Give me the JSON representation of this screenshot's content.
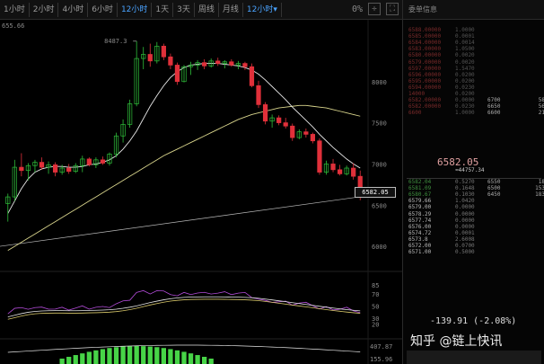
{
  "toolbar": {
    "timeframes": [
      "1小时",
      "2小时",
      "4小时",
      "6小时",
      "12小时",
      "1天",
      "3天",
      "周线",
      "月线",
      "12小时▾"
    ],
    "active": [
      4,
      9
    ],
    "icon_right_1": "0%",
    "icon_right_2": "crosshair-icon",
    "icon_right_3": "fullscreen-icon"
  },
  "chart_data": {
    "type": "candlestick",
    "y_range": [
      5750,
      8750
    ],
    "y_ticks": [
      8000,
      7500,
      7000,
      6500,
      6000
    ],
    "top_left_label": "655.66",
    "high_annotation": "8487.3",
    "current_price_tag": "6582.05",
    "candles": [
      {
        "o": 6520,
        "h": 6640,
        "l": 6300,
        "c": 6600
      },
      {
        "o": 6600,
        "h": 7050,
        "l": 6550,
        "c": 6960
      },
      {
        "o": 6960,
        "h": 7130,
        "l": 6850,
        "c": 6920
      },
      {
        "o": 6920,
        "h": 7010,
        "l": 6800,
        "c": 6980
      },
      {
        "o": 6980,
        "h": 7050,
        "l": 6900,
        "c": 7020
      },
      {
        "o": 7020,
        "h": 7080,
        "l": 6930,
        "c": 6960
      },
      {
        "o": 6960,
        "h": 7030,
        "l": 6880,
        "c": 6990
      },
      {
        "o": 6990,
        "h": 7020,
        "l": 6850,
        "c": 6900
      },
      {
        "o": 6900,
        "h": 6990,
        "l": 6870,
        "c": 6950
      },
      {
        "o": 6950,
        "h": 7000,
        "l": 6880,
        "c": 6910
      },
      {
        "o": 6910,
        "h": 7010,
        "l": 6890,
        "c": 6980
      },
      {
        "o": 6980,
        "h": 7100,
        "l": 6900,
        "c": 7060
      },
      {
        "o": 7060,
        "h": 7080,
        "l": 6970,
        "c": 6990
      },
      {
        "o": 6990,
        "h": 7080,
        "l": 6950,
        "c": 7050
      },
      {
        "o": 7050,
        "h": 7090,
        "l": 6990,
        "c": 7010
      },
      {
        "o": 7010,
        "h": 7140,
        "l": 6980,
        "c": 7120
      },
      {
        "o": 7120,
        "h": 7380,
        "l": 7080,
        "c": 7340
      },
      {
        "o": 7340,
        "h": 7540,
        "l": 7260,
        "c": 7480
      },
      {
        "o": 7480,
        "h": 7780,
        "l": 7440,
        "c": 7730
      },
      {
        "o": 7730,
        "h": 8490,
        "l": 7700,
        "c": 8280
      },
      {
        "o": 8280,
        "h": 8420,
        "l": 8150,
        "c": 8330
      },
      {
        "o": 8330,
        "h": 8460,
        "l": 8180,
        "c": 8250
      },
      {
        "o": 8250,
        "h": 8480,
        "l": 8220,
        "c": 8430
      },
      {
        "o": 8430,
        "h": 8460,
        "l": 8260,
        "c": 8300
      },
      {
        "o": 8300,
        "h": 8340,
        "l": 8150,
        "c": 8200
      },
      {
        "o": 8200,
        "h": 8230,
        "l": 7960,
        "c": 8000
      },
      {
        "o": 8000,
        "h": 8200,
        "l": 7990,
        "c": 8180
      },
      {
        "o": 8180,
        "h": 8240,
        "l": 8080,
        "c": 8200
      },
      {
        "o": 8200,
        "h": 8260,
        "l": 8140,
        "c": 8230
      },
      {
        "o": 8230,
        "h": 8270,
        "l": 8150,
        "c": 8190
      },
      {
        "o": 8190,
        "h": 8280,
        "l": 8170,
        "c": 8250
      },
      {
        "o": 8250,
        "h": 8290,
        "l": 8190,
        "c": 8220
      },
      {
        "o": 8220,
        "h": 8260,
        "l": 8160,
        "c": 8240
      },
      {
        "o": 8240,
        "h": 8270,
        "l": 8180,
        "c": 8200
      },
      {
        "o": 8200,
        "h": 8250,
        "l": 8150,
        "c": 8220
      },
      {
        "o": 8220,
        "h": 8240,
        "l": 8140,
        "c": 8180
      },
      {
        "o": 8180,
        "h": 8220,
        "l": 7930,
        "c": 7950
      },
      {
        "o": 7950,
        "h": 8010,
        "l": 7680,
        "c": 7720
      },
      {
        "o": 7720,
        "h": 7750,
        "l": 7480,
        "c": 7520
      },
      {
        "o": 7520,
        "h": 7600,
        "l": 7440,
        "c": 7560
      },
      {
        "o": 7560,
        "h": 7590,
        "l": 7470,
        "c": 7500
      },
      {
        "o": 7500,
        "h": 7560,
        "l": 7430,
        "c": 7460
      },
      {
        "o": 7460,
        "h": 7490,
        "l": 7280,
        "c": 7320
      },
      {
        "o": 7320,
        "h": 7420,
        "l": 7300,
        "c": 7390
      },
      {
        "o": 7390,
        "h": 7430,
        "l": 7320,
        "c": 7360
      },
      {
        "o": 7360,
        "h": 7380,
        "l": 7250,
        "c": 7280
      },
      {
        "o": 7280,
        "h": 7310,
        "l": 6870,
        "c": 6900
      },
      {
        "o": 6900,
        "h": 7040,
        "l": 6870,
        "c": 7000
      },
      {
        "o": 7000,
        "h": 7060,
        "l": 6900,
        "c": 6930
      },
      {
        "o": 6930,
        "h": 6990,
        "l": 6860,
        "c": 6880
      },
      {
        "o": 6880,
        "h": 6980,
        "l": 6860,
        "c": 6950
      },
      {
        "o": 6950,
        "h": 7010,
        "l": 6810,
        "c": 6850
      },
      {
        "o": 6850,
        "h": 6920,
        "l": 6560,
        "c": 6600
      }
    ],
    "ma_long": [
      5950,
      6000,
      6050,
      6100,
      6150,
      6200,
      6250,
      6300,
      6350,
      6400,
      6450,
      6500,
      6550,
      6600,
      6650,
      6700,
      6750,
      6800,
      6850,
      6900,
      6950,
      7000,
      7050,
      7100,
      7140,
      7180,
      7220,
      7260,
      7300,
      7340,
      7380,
      7420,
      7460,
      7500,
      7540,
      7570,
      7600,
      7620,
      7640,
      7660,
      7680,
      7690,
      7700,
      7710,
      7710,
      7700,
      7690,
      7680,
      7660,
      7640,
      7620,
      7600,
      7580
    ],
    "ma_short": [
      6400,
      6550,
      6700,
      6820,
      6900,
      6940,
      6960,
      6970,
      6970,
      6960,
      6960,
      6970,
      6990,
      7000,
      7020,
      7050,
      7100,
      7180,
      7280,
      7400,
      7550,
      7700,
      7830,
      7950,
      8050,
      8120,
      8170,
      8200,
      8210,
      8220,
      8220,
      8220,
      8210,
      8200,
      8190,
      8170,
      8140,
      8090,
      8020,
      7940,
      7860,
      7780,
      7690,
      7610,
      7530,
      7450,
      7360,
      7280,
      7200,
      7130,
      7060,
      7000,
      6950
    ],
    "trendline": {
      "from": 6000,
      "to": 6600
    },
    "rsi_ticks": [
      85,
      70,
      50,
      30,
      20
    ],
    "macd_labels": [
      "407.87",
      "155.96"
    ]
  },
  "orderbook": {
    "title": "委单信息",
    "asks": [
      [
        "6588.00000",
        "1.0000"
      ],
      [
        "6585.00000",
        "0.0001"
      ],
      [
        "6584.00000",
        "0.0014"
      ],
      [
        "6583.00000",
        "1.0500"
      ],
      [
        "6580.00000",
        "0.0020"
      ],
      [
        "6579.00000",
        "0.0020"
      ],
      [
        "6597.00000",
        "1.5470"
      ],
      [
        "6596.00000",
        "0.0200"
      ],
      [
        "6595.00000",
        "0.0200"
      ],
      [
        "6594.00000",
        "0.0230"
      ],
      [
        "14000",
        "0.0200"
      ],
      [
        "6582.00000",
        "0.0000"
      ],
      [
        "6582.00000",
        "0.0230"
      ],
      [
        "6600",
        "1.0000"
      ]
    ],
    "asks_right": [
      [
        "6700",
        "58"
      ],
      [
        "6650",
        "56"
      ],
      [
        "6600",
        "21"
      ]
    ],
    "mid": {
      "price": "6582.05",
      "sub": "≈44757.34"
    },
    "bids": [
      [
        "6582.04",
        "0.5270"
      ],
      [
        "6581.09",
        "0.1648"
      ],
      [
        "6580.67",
        "0.1030"
      ],
      [
        "6579.66",
        "1.0420"
      ],
      [
        "6579.00",
        "0.0000"
      ],
      [
        "6578.29",
        "0.0000"
      ],
      [
        "6577.74",
        "0.0000"
      ],
      [
        "6576.00",
        "0.0000"
      ],
      [
        "6574.72",
        "0.0001"
      ],
      [
        "6573.8",
        "2.6008"
      ],
      [
        "6572.00",
        "0.0700"
      ],
      [
        "6571.00",
        "0.5000"
      ]
    ],
    "bids_right": [
      [
        "6550",
        "18"
      ],
      [
        "6500",
        "153"
      ],
      [
        "6450",
        "183"
      ]
    ],
    "change": "-139.91 (-2.08%)",
    "brand": "知乎 @链上快讯"
  }
}
